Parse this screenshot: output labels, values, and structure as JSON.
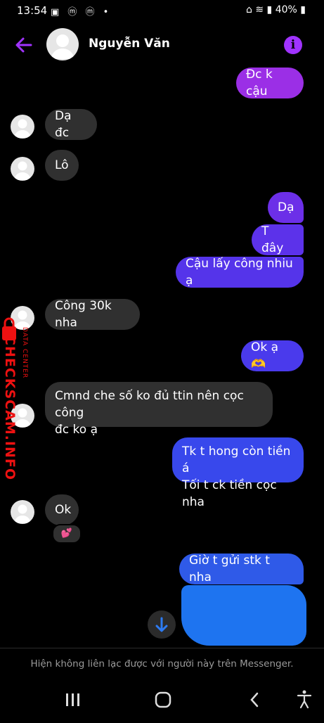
{
  "status_bar": {
    "time": "13:54",
    "battery": "40%"
  },
  "header": {
    "contact_name": "Nguyễn Văn"
  },
  "messages": [
    {
      "dir": "out",
      "text": "Đc k cậu"
    },
    {
      "dir": "in",
      "text": "Dạ đc"
    },
    {
      "dir": "in",
      "text": "Lô"
    },
    {
      "dir": "out",
      "text": "Dạ"
    },
    {
      "dir": "out",
      "text": "T đây"
    },
    {
      "dir": "out",
      "text": "Cậu lấy công nhiu ạ"
    },
    {
      "dir": "in",
      "text": "Công 30k nha"
    },
    {
      "dir": "out",
      "text": "Ok ạ 🫶"
    },
    {
      "dir": "in",
      "line1": "Cmnd che số ko đủ ttin nên cọc công",
      "line2": "đc ko ạ"
    },
    {
      "dir": "out",
      "line1": "Tk t hong còn tiền á",
      "line2": "Tối t ck tiền cọc nha"
    },
    {
      "dir": "in",
      "text": "Ok",
      "reaction": "💕"
    },
    {
      "dir": "out",
      "text": "Giờ t gửi stk t nha"
    }
  ],
  "watermark": {
    "brand": "CHECKSCAM.INFO",
    "sub": "DATA CENTER"
  },
  "footer": {
    "notice": "Hiện không liên lạc được với người này trên Messenger."
  },
  "colors": {
    "purple": "#8a2be2",
    "blue_end": "#2f5ae8",
    "redact": "#1e74f0"
  }
}
